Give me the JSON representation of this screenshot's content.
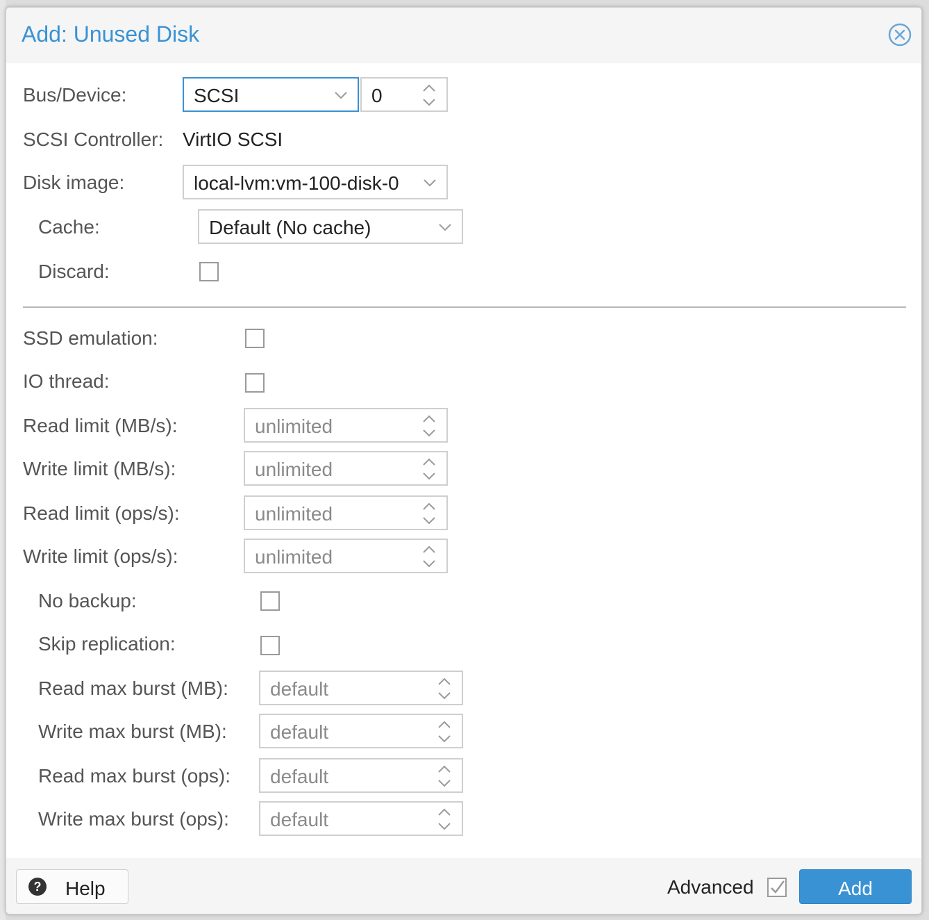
{
  "dialog": {
    "title": "Add: Unused Disk"
  },
  "form": {
    "bus_device_label": "Bus/Device:",
    "bus_value": "SCSI",
    "device_value": "0",
    "scsi_controller_label": "SCSI Controller:",
    "scsi_controller_value": "VirtIO SCSI",
    "disk_image_label": "Disk image:",
    "disk_image_value": "local-lvm:vm-100-disk-0",
    "cache_label": "Cache:",
    "cache_value": "Default (No cache)",
    "discard_label": "Discard:",
    "ssd_emulation_label": "SSD emulation:",
    "io_thread_label": "IO thread:",
    "read_limit_mbs_label": "Read limit (MB/s):",
    "read_limit_mbs_placeholder": "unlimited",
    "write_limit_mbs_label": "Write limit (MB/s):",
    "write_limit_mbs_placeholder": "unlimited",
    "read_limit_ops_label": "Read limit (ops/s):",
    "read_limit_ops_placeholder": "unlimited",
    "write_limit_ops_label": "Write limit (ops/s):",
    "write_limit_ops_placeholder": "unlimited",
    "no_backup_label": "No backup:",
    "skip_replication_label": "Skip replication:",
    "read_max_burst_mb_label": "Read max burst (MB):",
    "read_max_burst_mb_placeholder": "default",
    "write_max_burst_mb_label": "Write max burst (MB):",
    "write_max_burst_mb_placeholder": "default",
    "read_max_burst_ops_label": "Read max burst (ops):",
    "read_max_burst_ops_placeholder": "default",
    "write_max_burst_ops_label": "Write max burst (ops):",
    "write_max_burst_ops_placeholder": "default"
  },
  "footer": {
    "help_label": "Help",
    "advanced_label": "Advanced",
    "add_label": "Add"
  },
  "colors": {
    "accent": "#3892d4"
  }
}
